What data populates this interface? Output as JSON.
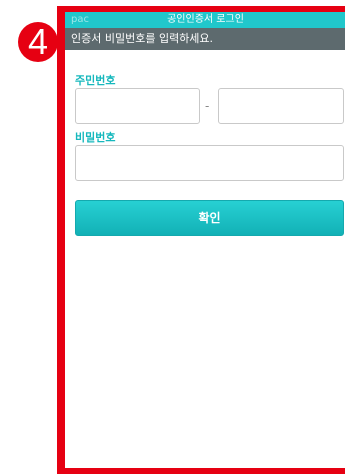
{
  "step": {
    "number": "4"
  },
  "title_bar": {
    "app_label": "pac",
    "title": "공인인증서 로그인"
  },
  "instruction": "인증서 비밀번호를 입력하세요.",
  "form": {
    "id_label": "주민번호",
    "id_separator": "-",
    "password_label": "비밀번호",
    "id_front_value": "",
    "id_back_value": "",
    "password_value": ""
  },
  "confirm_button": {
    "label": "확인"
  },
  "colors": {
    "accent": "#21c7cb",
    "instruction_bar": "#5d6a6e",
    "highlight": "#e60012"
  }
}
